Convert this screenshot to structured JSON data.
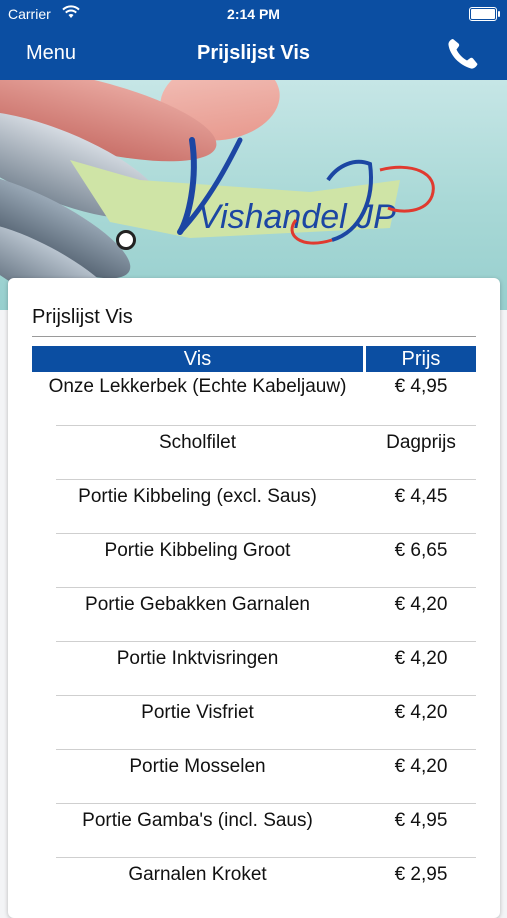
{
  "status_bar": {
    "carrier": "Carrier",
    "time": "2:14 PM"
  },
  "nav": {
    "menu_label": "Menu",
    "title": "Prijslijst Vis",
    "call_icon": "phone-icon"
  },
  "hero": {
    "logo_text": "Vishandel JP"
  },
  "card": {
    "title": "Prijslijst Vis",
    "columns": {
      "name": "Vis",
      "price": "Prijs"
    },
    "items": [
      {
        "name": "Onze Lekkerbek (Echte Kabeljauw)",
        "price": "€ 4,95"
      },
      {
        "name": "Scholfilet",
        "price": "Dagprijs"
      },
      {
        "name": "Portie Kibbeling (excl. Saus)",
        "price": "€ 4,45"
      },
      {
        "name": "Portie Kibbeling Groot",
        "price": "€ 6,65"
      },
      {
        "name": "Portie Gebakken Garnalen",
        "price": "€ 4,20"
      },
      {
        "name": "Portie Inktvisringen",
        "price": "€ 4,20"
      },
      {
        "name": "Portie Visfriet",
        "price": "€ 4,20"
      },
      {
        "name": "Portie Mosselen",
        "price": "€ 4,20"
      },
      {
        "name": "Portie Gamba's (incl. Saus)",
        "price": "€ 4,95"
      },
      {
        "name": "Garnalen Kroket",
        "price": "€ 2,95"
      }
    ]
  },
  "colors": {
    "brand_blue": "#0b4ea2",
    "logo_green": "#cfe4a6"
  }
}
